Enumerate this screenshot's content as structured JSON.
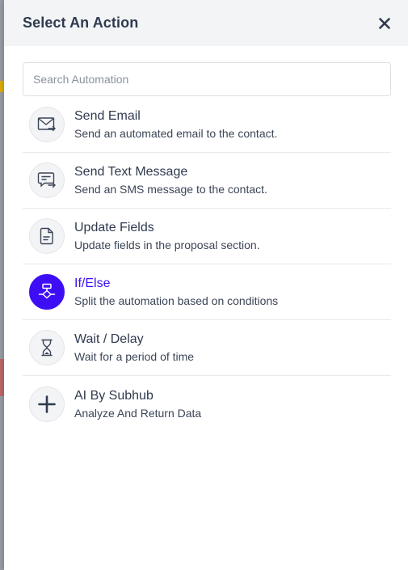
{
  "panel": {
    "title": "Select An Action",
    "close_icon": "close-icon"
  },
  "search": {
    "value": "",
    "placeholder": "Search Automation"
  },
  "colors": {
    "accent": "#3d0ef5",
    "text": "#2f3a4f",
    "header_bg": "#f3f4f6"
  },
  "actions": [
    {
      "icon": "mail-icon",
      "title": "Send Email",
      "desc": "Send an automated email to the contact."
    },
    {
      "icon": "message-icon",
      "title": "Send Text Message",
      "desc": "Send an SMS message to the contact."
    },
    {
      "icon": "document-icon",
      "title": "Update Fields",
      "desc": "Update fields in the proposal section."
    },
    {
      "icon": "branch-icon",
      "title": "If/Else",
      "desc": "Split the automation based on conditions",
      "active": true
    },
    {
      "icon": "hourglass-icon",
      "title": "Wait / Delay",
      "desc": "Wait for a period of time"
    },
    {
      "icon": "plus-icon",
      "title": "AI By Subhub",
      "desc": "Analyze And Return Data"
    }
  ]
}
